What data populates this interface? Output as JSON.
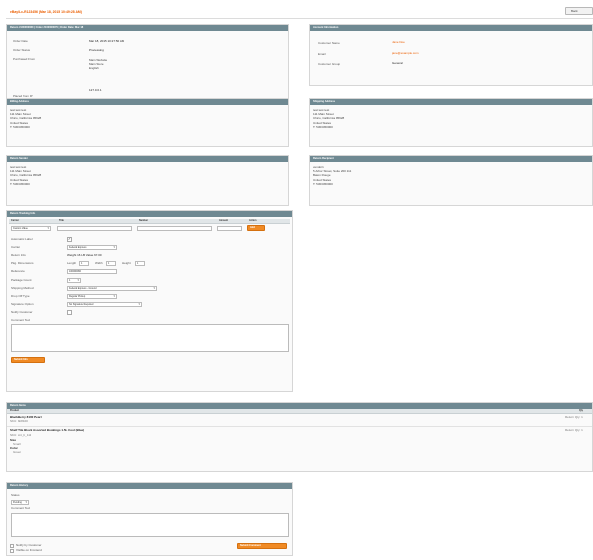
{
  "header": {
    "title": "eBay/Lc-R123456 (Mar 18, 2015 10:49:28 AM)",
    "back_label": "Back"
  },
  "order_info": {
    "heading": "Return #100000060 | Order #100000070 | Order Date: Mar 18",
    "fields": [
      {
        "label": "Order Date",
        "value": "Mar 18, 2015 10:27:50 AM"
      },
      {
        "label": "Order Status",
        "value": "Processing"
      },
      {
        "label": "Purchased From",
        "value": "Main Website\nMain Store\nEnglish"
      },
      {
        "label": "Placed from IP",
        "value": "127.0.0.1"
      }
    ]
  },
  "account_info": {
    "heading": "Account Information",
    "fields": [
      {
        "label": "Customer Name",
        "value": "Jane Doe",
        "link": true
      },
      {
        "label": "Email",
        "value": "jane@example.com",
        "link": true
      },
      {
        "label": "Customer Group",
        "value": "General",
        "link": false
      }
    ]
  },
  "billing_address": {
    "heading": "Billing Address",
    "lines": "test test test\n111 Main Street\nChico, California 95928\nUnited States\nT: 5303450000"
  },
  "shipping_address": {
    "heading": "Shipping Address",
    "lines": "test test test\n111 Main Street\nChico, California 95928\nUnited States\nT: 5303450000"
  },
  "return_sender": {
    "heading": "Return Sender",
    "lines": "test test test\n111 Main Street\nChico, California 95928\nUnited States\nT: 5303450000"
  },
  "return_recipient": {
    "heading": "Return Recipient",
    "lines": "vendor1\n5 Arbor Street, Suite 200 111\nBaton Rouge\nUnited States\nT: 5303450000"
  },
  "tracking": {
    "heading": "Return Tracking Info",
    "columns": {
      "carrier": "Carrier",
      "title": "Title",
      "number": "Number",
      "amount": "Amount",
      "action": "Action"
    },
    "carrier_value": "Custom Value",
    "add_label": "Add",
    "fields": {
      "automatic_label": {
        "label": "Automatic Label",
        "checked": true
      },
      "carrier": {
        "label": "Carrier",
        "value": "Federal Express"
      },
      "dimensions_label": "Return Info",
      "weight_text": "Weight 16 LB  Value 67.00",
      "package_dimensions": {
        "label": "Pkg. Dimensions",
        "length_label": "Length",
        "length": "1",
        "width_label": "Width",
        "width": "1",
        "height_label": "Height",
        "height": "1"
      },
      "reference": {
        "label": "Reference",
        "value": "100000060"
      },
      "package_count": {
        "label": "Package Count",
        "value": "1"
      },
      "shipping_method": {
        "label": "Shipping Method",
        "value": "Federal Express - Ground"
      },
      "drop_off": {
        "label": "Drop Off Type",
        "value": "Regular Pickup"
      },
      "signature": {
        "label": "Signature Option",
        "value": "No Signature Required"
      },
      "notify": {
        "label": "Notify Customer",
        "checked": false
      },
      "comment_label": "Comment Text"
    },
    "submit_label": "Submit Info"
  },
  "return_items": {
    "heading": "Return Items",
    "columns": {
      "product": "Product",
      "qty": "Qty"
    },
    "items": [
      {
        "name": "BlackBerry 8100 Pearl",
        "sku": "SKU: bb8100",
        "status": "Return Qty: 1"
      },
      {
        "name": "Shelf Tile Block Assorted Bookings 1.5L Cool (Blue)",
        "sku": "SKU: cnt_b_111",
        "extra": [
          "Size",
          "Small",
          "Color",
          "Green"
        ],
        "status": "Return Qty: 1"
      }
    ]
  },
  "return_history": {
    "heading": "Return History",
    "status_label": "Status",
    "status_value": "Pending",
    "comment_label": "Comment Text",
    "notify_label": "Notify by Customer",
    "visible_label": "Visible on Frontend",
    "submit_label": "Submit Comment"
  }
}
